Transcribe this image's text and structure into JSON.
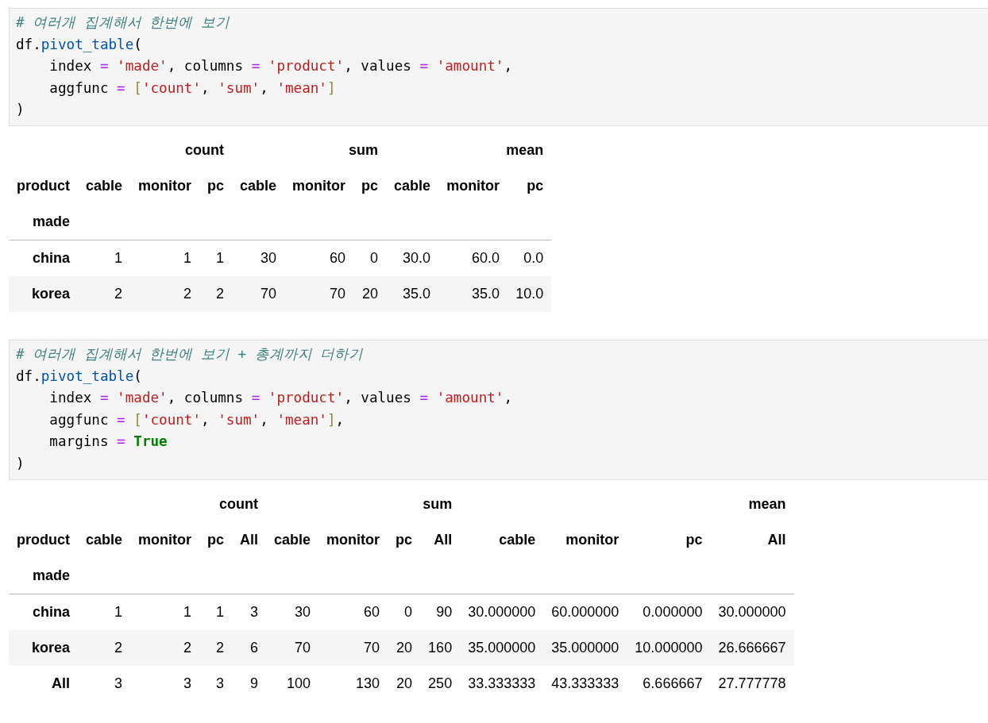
{
  "cells": [
    {
      "kind": "code",
      "lines": [
        [
          {
            "kind": "comment",
            "text": "# 여러개 집계해서 한번에 보기"
          }
        ],
        [
          {
            "kind": "name",
            "text": "df."
          },
          {
            "kind": "attr",
            "text": "pivot_table"
          },
          {
            "kind": "punct",
            "text": "("
          }
        ],
        [
          {
            "kind": "name",
            "text": "    index "
          },
          {
            "kind": "op",
            "text": "="
          },
          {
            "kind": "string",
            "text": " 'made'"
          },
          {
            "kind": "punct",
            "text": ", columns "
          },
          {
            "kind": "op",
            "text": "="
          },
          {
            "kind": "string",
            "text": " 'product'"
          },
          {
            "kind": "punct",
            "text": ", values "
          },
          {
            "kind": "op",
            "text": "="
          },
          {
            "kind": "string",
            "text": " 'amount'"
          },
          {
            "kind": "punct",
            "text": ","
          }
        ],
        [
          {
            "kind": "name",
            "text": "    aggfunc "
          },
          {
            "kind": "op",
            "text": "="
          },
          {
            "kind": "bracket",
            "text": " ["
          },
          {
            "kind": "string",
            "text": "'count'"
          },
          {
            "kind": "punct",
            "text": ", "
          },
          {
            "kind": "string",
            "text": "'sum'"
          },
          {
            "kind": "punct",
            "text": ", "
          },
          {
            "kind": "string",
            "text": "'mean'"
          },
          {
            "kind": "bracket",
            "text": "]"
          }
        ],
        [
          {
            "kind": "punct",
            "text": ")"
          }
        ]
      ]
    },
    {
      "kind": "table",
      "columns_name": "product",
      "index_name": "made",
      "groups": [
        {
          "label": "count",
          "columns": [
            "cable",
            "monitor",
            "pc"
          ]
        },
        {
          "label": "sum",
          "columns": [
            "cable",
            "monitor",
            "pc"
          ]
        },
        {
          "label": "mean",
          "columns": [
            "cable",
            "monitor",
            "pc"
          ]
        }
      ],
      "rows": [
        {
          "label": "china",
          "values": [
            "1",
            "1",
            "1",
            "30",
            "60",
            "0",
            "30.0",
            "60.0",
            "0.0"
          ]
        },
        {
          "label": "korea",
          "values": [
            "2",
            "2",
            "2",
            "70",
            "70",
            "20",
            "35.0",
            "35.0",
            "10.0"
          ]
        }
      ]
    },
    {
      "kind": "code",
      "lines": [
        [
          {
            "kind": "comment",
            "text": "# 여러개 집계해서 한번에 보기 + 총계까지 더하기"
          }
        ],
        [
          {
            "kind": "name",
            "text": "df."
          },
          {
            "kind": "attr",
            "text": "pivot_table"
          },
          {
            "kind": "punct",
            "text": "("
          }
        ],
        [
          {
            "kind": "name",
            "text": "    index "
          },
          {
            "kind": "op",
            "text": "="
          },
          {
            "kind": "string",
            "text": " 'made'"
          },
          {
            "kind": "punct",
            "text": ", columns "
          },
          {
            "kind": "op",
            "text": "="
          },
          {
            "kind": "string",
            "text": " 'product'"
          },
          {
            "kind": "punct",
            "text": ", values "
          },
          {
            "kind": "op",
            "text": "="
          },
          {
            "kind": "string",
            "text": " 'amount'"
          },
          {
            "kind": "punct",
            "text": ","
          }
        ],
        [
          {
            "kind": "name",
            "text": "    aggfunc "
          },
          {
            "kind": "op",
            "text": "="
          },
          {
            "kind": "bracket",
            "text": " ["
          },
          {
            "kind": "string",
            "text": "'count'"
          },
          {
            "kind": "punct",
            "text": ", "
          },
          {
            "kind": "string",
            "text": "'sum'"
          },
          {
            "kind": "punct",
            "text": ", "
          },
          {
            "kind": "string",
            "text": "'mean'"
          },
          {
            "kind": "bracket",
            "text": "]"
          },
          {
            "kind": "punct",
            "text": ","
          }
        ],
        [
          {
            "kind": "name",
            "text": "    margins "
          },
          {
            "kind": "op",
            "text": "="
          },
          {
            "kind": "keyword",
            "text": " True"
          }
        ],
        [
          {
            "kind": "punct",
            "text": ")"
          }
        ]
      ]
    },
    {
      "kind": "table",
      "columns_name": "product",
      "index_name": "made",
      "groups": [
        {
          "label": "count",
          "columns": [
            "cable",
            "monitor",
            "pc",
            "All"
          ]
        },
        {
          "label": "sum",
          "columns": [
            "cable",
            "monitor",
            "pc",
            "All"
          ]
        },
        {
          "label": "mean",
          "columns": [
            "cable",
            "monitor",
            "pc",
            "All"
          ]
        }
      ],
      "rows": [
        {
          "label": "china",
          "values": [
            "1",
            "1",
            "1",
            "3",
            "30",
            "60",
            "0",
            "90",
            "30.000000",
            "60.000000",
            "0.000000",
            "30.000000"
          ]
        },
        {
          "label": "korea",
          "values": [
            "2",
            "2",
            "2",
            "6",
            "70",
            "70",
            "20",
            "160",
            "35.000000",
            "35.000000",
            "10.000000",
            "26.666667"
          ]
        },
        {
          "label": "All",
          "values": [
            "3",
            "3",
            "3",
            "9",
            "100",
            "130",
            "20",
            "250",
            "33.333333",
            "43.333333",
            "6.666667",
            "27.777778"
          ]
        }
      ]
    }
  ]
}
